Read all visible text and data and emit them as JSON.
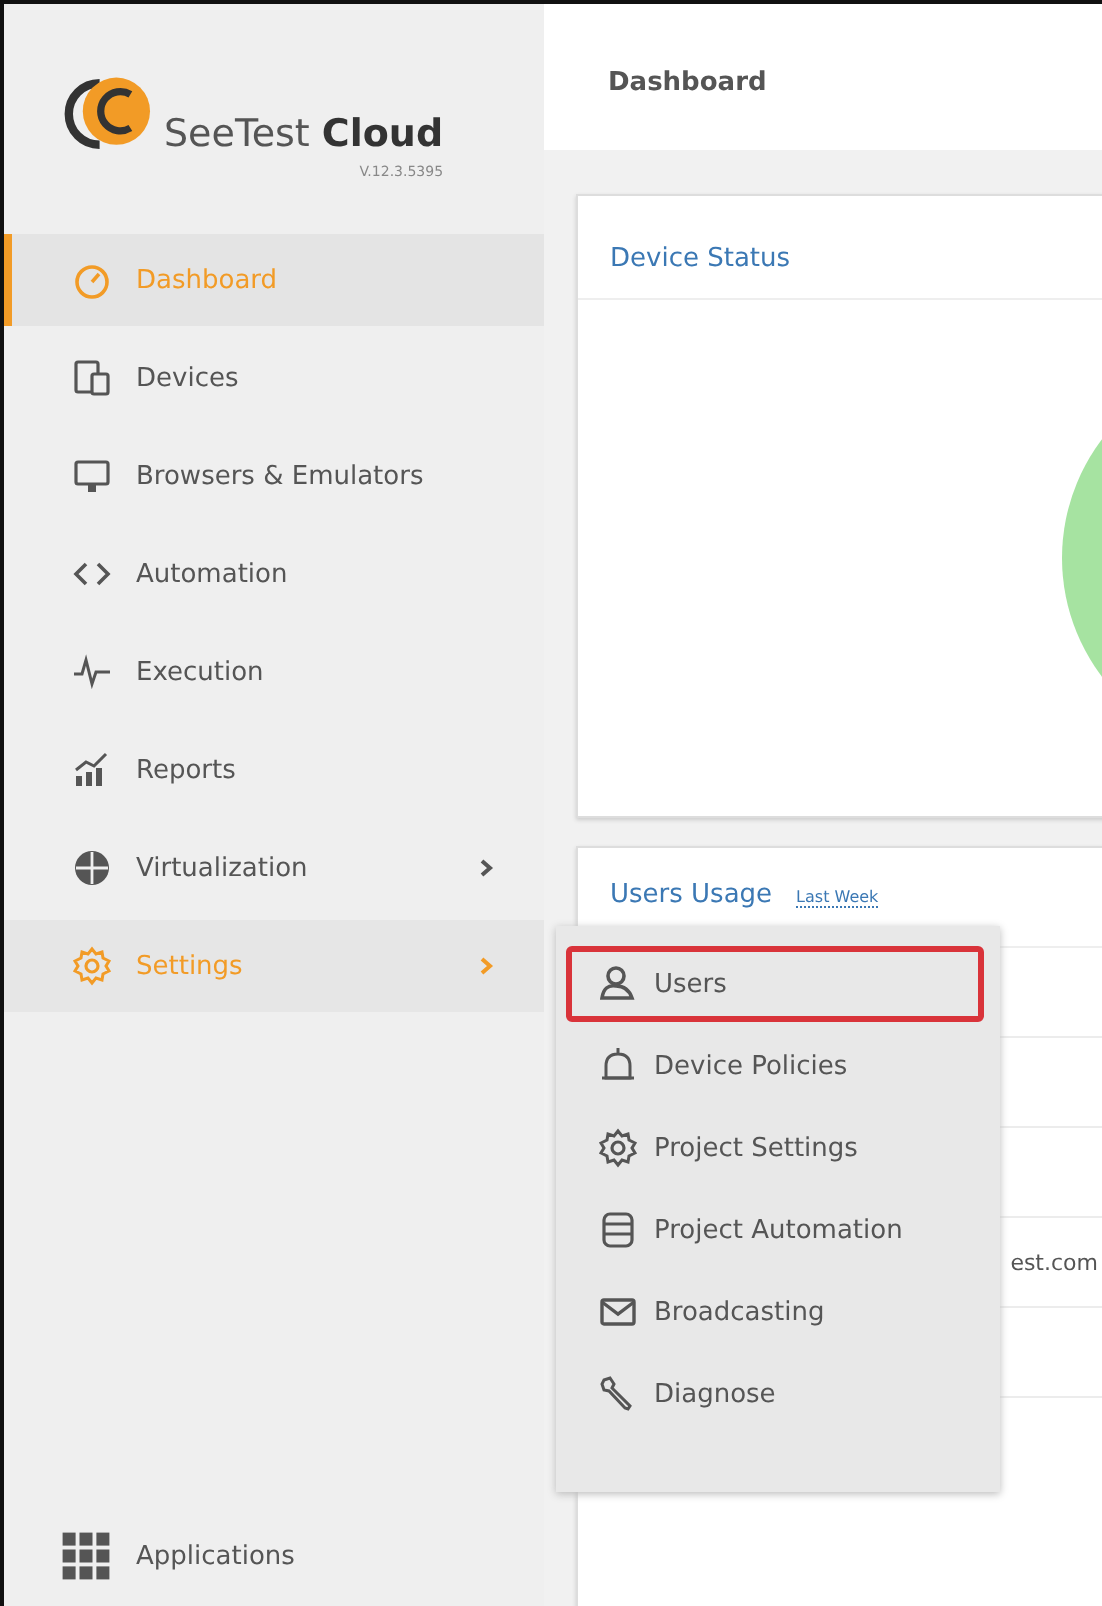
{
  "logo": {
    "name_light": "SeeTest",
    "name_bold": "Cloud",
    "version": "V.12.3.5395"
  },
  "sidebar": {
    "items": [
      {
        "label": "Dashboard",
        "selected": true,
        "expanded": false,
        "has_submenu": false
      },
      {
        "label": "Devices",
        "selected": false,
        "expanded": false,
        "has_submenu": false
      },
      {
        "label": "Browsers & Emulators",
        "selected": false,
        "expanded": false,
        "has_submenu": false
      },
      {
        "label": "Automation",
        "selected": false,
        "expanded": false,
        "has_submenu": false
      },
      {
        "label": "Execution",
        "selected": false,
        "expanded": false,
        "has_submenu": false
      },
      {
        "label": "Reports",
        "selected": false,
        "expanded": false,
        "has_submenu": false
      },
      {
        "label": "Virtualization",
        "selected": false,
        "expanded": false,
        "has_submenu": true
      },
      {
        "label": "Settings",
        "selected": false,
        "expanded": true,
        "has_submenu": true
      }
    ],
    "footer": {
      "label": "Applications"
    }
  },
  "header": {
    "title": "Dashboard"
  },
  "device_status": {
    "title": "Device Status"
  },
  "users_usage": {
    "title": "Users Usage",
    "period": "Last Week",
    "rows": [
      {
        "text": ""
      },
      {
        "text": ""
      },
      {
        "text": ""
      },
      {
        "text": "est.com"
      },
      {
        "text": ""
      }
    ]
  },
  "settings_menu": {
    "items": [
      {
        "label": "Users",
        "highlighted": true
      },
      {
        "label": "Device Policies",
        "highlighted": false
      },
      {
        "label": "Project Settings",
        "highlighted": false
      },
      {
        "label": "Project Automation",
        "highlighted": false
      },
      {
        "label": "Broadcasting",
        "highlighted": false
      },
      {
        "label": "Diagnose",
        "highlighted": false
      }
    ]
  }
}
